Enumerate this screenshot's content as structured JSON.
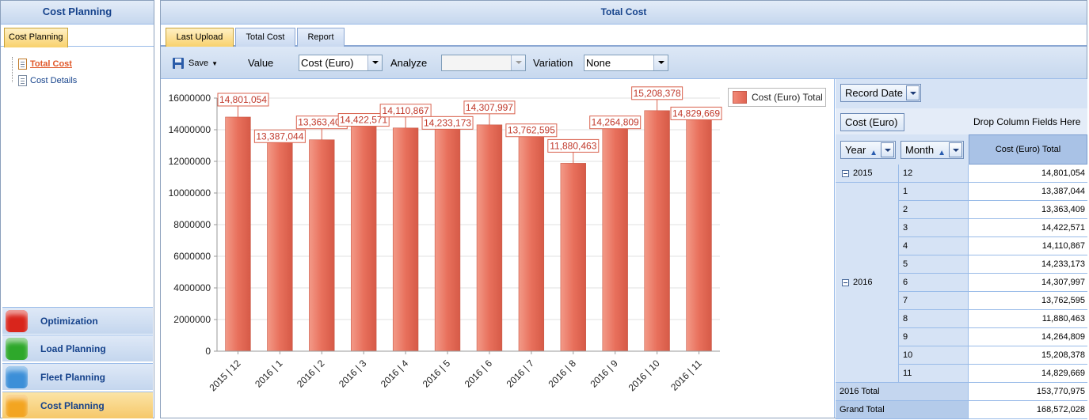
{
  "left_panel": {
    "title": "Cost Planning",
    "tab_label": "Cost Planning",
    "tree_items": [
      "Total Cost",
      "Cost Details"
    ],
    "nav_buttons": [
      {
        "label": "Optimization",
        "color": "#d9251c"
      },
      {
        "label": "Load Planning",
        "color": "#2ea82b"
      },
      {
        "label": "Fleet Planning",
        "color": "#3c8fd8"
      },
      {
        "label": "Cost Planning",
        "color": "#f3a521"
      }
    ]
  },
  "main_panel": {
    "title": "Total Cost",
    "tabs": [
      "Last Upload",
      "Total Cost",
      "Report"
    ],
    "active_tab": "Last Upload"
  },
  "toolbar": {
    "save_label": "Save",
    "value_label": "Value",
    "value_selected": "Cost (Euro)",
    "analyze_label": "Analyze",
    "analyze_selected": "",
    "variation_label": "Variation",
    "variation_selected": "None"
  },
  "chart_data": {
    "type": "bar",
    "categories": [
      "2015 | 12",
      "2016 | 1",
      "2016 | 2",
      "2016 | 3",
      "2016 | 4",
      "2016 | 5",
      "2016 | 6",
      "2016 | 7",
      "2016 | 8",
      "2016 | 9",
      "2016 | 10",
      "2016 | 11"
    ],
    "series": [
      {
        "name": "Cost (Euro) Total",
        "values": [
          14801054,
          13387044,
          13363409,
          14422571,
          14110867,
          14233173,
          14307997,
          13762595,
          11880463,
          14264809,
          15208378,
          14829669
        ]
      }
    ],
    "data_labels": [
      "14,801,054",
      "13,387,044",
      "13,363,409",
      "14,422,571",
      "14,110,867",
      "14,233,173",
      "14,307,997",
      "13,762,595",
      "11,880,463",
      "14,264,809",
      "15,208,378",
      "14,829,669"
    ],
    "yticks": [
      "0",
      "2000000",
      "4000000",
      "6000000",
      "8000000",
      "10000000",
      "12000000",
      "14000000",
      "16000000"
    ],
    "ylim": [
      0,
      16000000
    ],
    "grid": true,
    "legend_position": "top-right",
    "bar_color": "#e46c5a"
  },
  "pivot": {
    "filter_field": "Record Date",
    "data_field": "Cost (Euro)",
    "column_drop_hint": "Drop Column Fields Here",
    "row_fields": [
      "Year",
      "Month"
    ],
    "value_header": "Cost (Euro) Total",
    "groups": [
      {
        "year": "2015",
        "rows": [
          {
            "month": "12",
            "value": "14,801,054"
          }
        ]
      },
      {
        "year": "2016",
        "rows": [
          {
            "month": "1",
            "value": "13,387,044"
          },
          {
            "month": "2",
            "value": "13,363,409"
          },
          {
            "month": "3",
            "value": "14,422,571"
          },
          {
            "month": "4",
            "value": "14,110,867"
          },
          {
            "month": "5",
            "value": "14,233,173"
          },
          {
            "month": "6",
            "value": "14,307,997"
          },
          {
            "month": "7",
            "value": "13,762,595"
          },
          {
            "month": "8",
            "value": "11,880,463"
          },
          {
            "month": "9",
            "value": "14,264,809"
          },
          {
            "month": "10",
            "value": "15,208,378"
          },
          {
            "month": "11",
            "value": "14,829,669"
          }
        ]
      }
    ],
    "subtotal_label": "2016 Total",
    "subtotal_value": "153,770,975",
    "grand_total_label": "Grand Total",
    "grand_total_value": "168,572,028"
  }
}
